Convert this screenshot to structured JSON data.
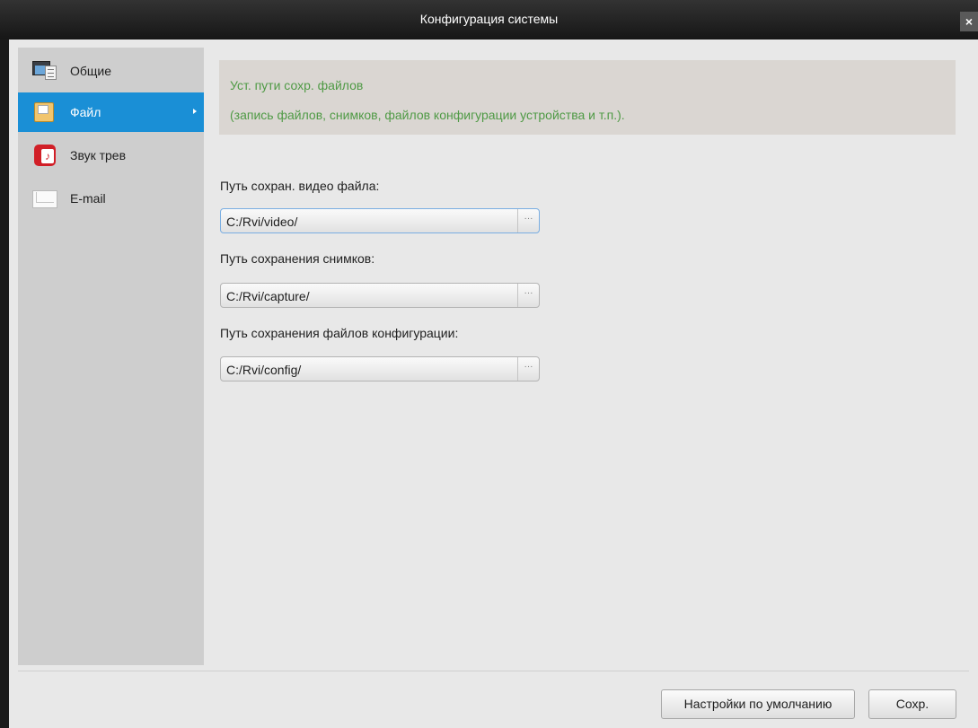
{
  "window": {
    "title": "Конфигурация системы",
    "close_glyph": "×"
  },
  "sidebar": {
    "items": [
      {
        "label": "Общие",
        "icon": "general-settings-icon"
      },
      {
        "label": "Файл",
        "icon": "file-folder-icon",
        "active": true
      },
      {
        "label": "Звук трев",
        "icon": "alarm-sound-icon"
      },
      {
        "label": "E-mail",
        "icon": "email-envelope-icon"
      }
    ]
  },
  "info": {
    "line1": "Уст. пути сохр. файлов",
    "line2": "(запись файлов, снимков, файлов конфигурации устройства и т.п.)."
  },
  "fields": [
    {
      "label": "Путь сохран. видео файла:",
      "value": "C:/Rvi/video/"
    },
    {
      "label": "Путь сохранения снимков:",
      "value": "C:/Rvi/capture/"
    },
    {
      "label": "Путь сохранения файлов конфигурации:",
      "value": "C:/Rvi/config/"
    }
  ],
  "browse_glyph": "···",
  "buttons": {
    "defaults": "Настройки по умолчанию",
    "save": "Сохр."
  },
  "colors": {
    "accent": "#1a8fd6",
    "info_text": "#4f9a45",
    "titlebar": "#1b1b1b"
  }
}
